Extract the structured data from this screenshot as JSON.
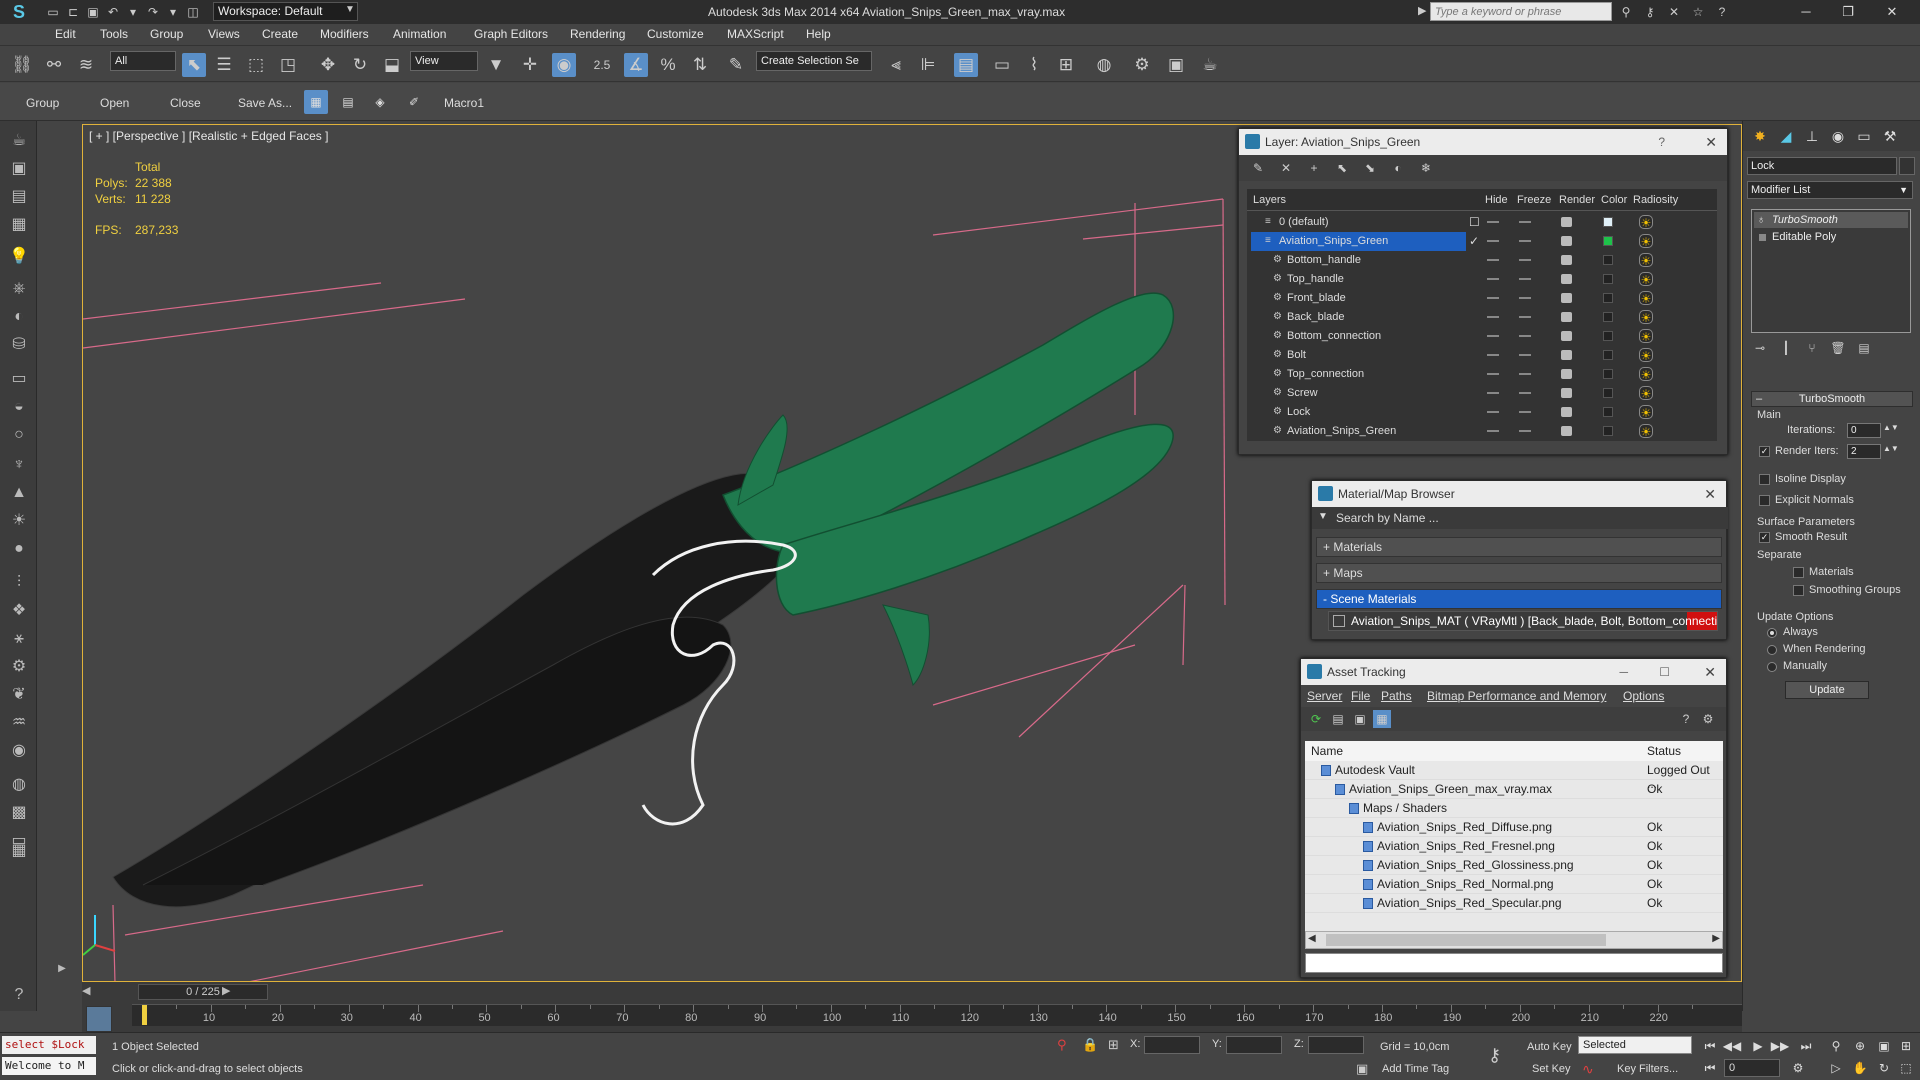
{
  "app": {
    "window_title": "Autodesk 3ds Max  2014 x64     Aviation_Snips_Green_max_vray.max",
    "workspace": "Workspace: Default",
    "search_placeholder": "Type a keyword or phrase"
  },
  "menu": [
    "Edit",
    "Tools",
    "Group",
    "Views",
    "Create",
    "Modifiers",
    "Animation",
    "Graph Editors",
    "Rendering",
    "Customize",
    "MAXScript",
    "Help"
  ],
  "toolbar": {
    "selection_filter": "All",
    "ref_coord": "View",
    "snap_value": "2.5",
    "named_selection": "Create Selection Se"
  },
  "secondary_toolbar": {
    "group": "Group",
    "open": "Open",
    "close": "Close",
    "save_as": "Save As...",
    "macro": "Macro1"
  },
  "viewport": {
    "label": "[ + ] [Perspective ] [Realistic + Edged Faces ]",
    "stats_header": "Total",
    "polys_label": "Polys:",
    "polys_value": "22 388",
    "verts_label": "Verts:",
    "verts_value": "11 228",
    "fps_label": "FPS:",
    "fps_value": "287,233"
  },
  "layer_panel": {
    "title": "Layer: Aviation_Snips_Green",
    "help": "?",
    "columns": [
      "Layers",
      "Hide",
      "Freeze",
      "Render",
      "Color",
      "Radiosity"
    ],
    "rows": [
      {
        "name": "0 (default)",
        "color": "#e0f0f8"
      },
      {
        "name": "Aviation_Snips_Green",
        "color": "#1ec24a"
      },
      {
        "name": "Bottom_handle",
        "color": "#222222"
      },
      {
        "name": "Top_handle",
        "color": "#222222"
      },
      {
        "name": "Front_blade",
        "color": "#222222"
      },
      {
        "name": "Back_blade",
        "color": "#222222"
      },
      {
        "name": "Bottom_connection",
        "color": "#222222"
      },
      {
        "name": "Bolt",
        "color": "#222222"
      },
      {
        "name": "Top_connection",
        "color": "#222222"
      },
      {
        "name": "Screw",
        "color": "#222222"
      },
      {
        "name": "Lock",
        "color": "#222222"
      },
      {
        "name": "Aviation_Snips_Green",
        "color": "#222222"
      }
    ]
  },
  "material_browser": {
    "title": "Material/Map Browser",
    "search_placeholder": "Search by Name ...",
    "groups": [
      "+ Materials",
      "+ Maps",
      "- Scene Materials"
    ],
    "item": "Aviation_Snips_MAT ( VRayMtl ) [Back_blade, Bolt, Bottom_connecti..."
  },
  "asset_tracking": {
    "title": "Asset Tracking",
    "menu": [
      "Server",
      "File",
      "Paths",
      "Bitmap Performance and Memory",
      "Options"
    ],
    "columns": [
      "Name",
      "Status"
    ],
    "rows": [
      {
        "name": "Autodesk Vault",
        "status": "Logged Out ..."
      },
      {
        "name": "Aviation_Snips_Green_max_vray.max",
        "status": "Ok"
      },
      {
        "name": "Maps / Shaders",
        "status": ""
      },
      {
        "name": "Aviation_Snips_Red_Diffuse.png",
        "status": "Ok"
      },
      {
        "name": "Aviation_Snips_Red_Fresnel.png",
        "status": "Ok"
      },
      {
        "name": "Aviation_Snips_Red_Glossiness.png",
        "status": "Ok"
      },
      {
        "name": "Aviation_Snips_Red_Normal.png",
        "status": "Ok"
      },
      {
        "name": "Aviation_Snips_Red_Specular.png",
        "status": "Ok"
      }
    ]
  },
  "command_panel": {
    "object_name": "Lock",
    "modifier_list": "Modifier List",
    "stack": [
      "TurboSmooth",
      "Editable Poly"
    ],
    "turbosmooth": {
      "title": "TurboSmooth",
      "main": "Main",
      "iterations_label": "Iterations:",
      "iterations": "0",
      "render_iters_label": "Render Iters:",
      "render_iters": "2",
      "isoline": "Isoline Display",
      "explicit": "Explicit Normals",
      "surface": "Surface Parameters",
      "smooth_result": "Smooth Result",
      "separate": "Separate",
      "materials": "Materials",
      "smoothing_groups": "Smoothing Groups",
      "update_options": "Update Options",
      "always": "Always",
      "when_rendering": "When Rendering",
      "manually": "Manually",
      "update": "Update"
    }
  },
  "timeline": {
    "frame": "0 / 225",
    "ticks": [
      "10",
      "20",
      "30",
      "40",
      "50",
      "60",
      "70",
      "80",
      "90",
      "100",
      "110",
      "120",
      "130",
      "140",
      "150",
      "160",
      "170",
      "180",
      "190",
      "200",
      "210",
      "220"
    ]
  },
  "status_bar": {
    "maxscript_line1": "select $Lock",
    "maxscript_line2": "Welcome to M",
    "selection": "1 Object Selected",
    "prompt": "Click or click-and-drag to select objects",
    "x_label": "X:",
    "y_label": "Y:",
    "z_label": "Z:",
    "grid": "Grid = 10,0cm",
    "add_time_tag": "Add Time Tag",
    "auto_key": "Auto Key",
    "set_key": "Set Key",
    "selected": "Selected",
    "key_filters": "Key Filters...",
    "frame_value": "0"
  }
}
